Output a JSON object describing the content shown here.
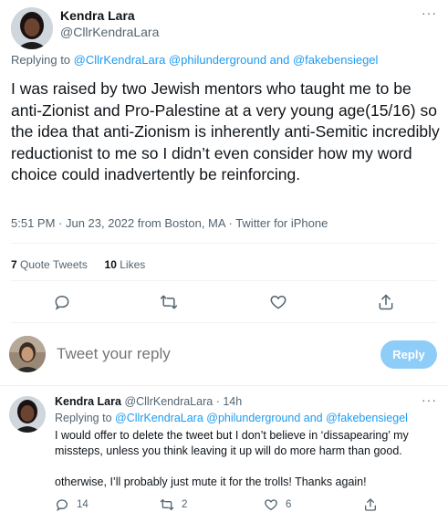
{
  "main_tweet": {
    "author_name": "Kendra Lara",
    "author_handle": "@CllrKendraLara",
    "replying_prefix": "Replying to",
    "replying_handles": "@CllrKendraLara @philunderground and @fakebensiegel",
    "text": "I was raised by two Jewish mentors who taught me to be anti-Zionist and Pro-Palestine at a very young age(15/16) so the idea that anti-Zionism is inherently anti-Semitic incredibly reductionist to me so I didn’t even consider how my word choice could inadvertently be reinforcing.",
    "timestamp": "5:51 PM · Jun 23, 2022 from Boston, MA",
    "client": "· Twitter for iPhone",
    "quote_count": "7",
    "quote_label": "Quote Tweets",
    "like_count": "10",
    "like_label": "Likes",
    "more_icon": "···"
  },
  "compose": {
    "placeholder": "Tweet your reply",
    "button_label": "Reply"
  },
  "reply_tweet": {
    "author_name": "Kendra Lara",
    "author_handle": "@CllrKendraLara",
    "time": "· 14h",
    "replying_prefix": "Replying to",
    "replying_handles": "@CllrKendraLara @philunderground and @fakebensiegel",
    "paragraph_1": "I would offer to delete the tweet but I don’t believe in ‘dissapearing’ my missteps, unless you think leaving it up will do more harm than good.",
    "paragraph_2": "otherwise, I’ll probably just mute it for the trolls! Thanks again!",
    "reply_count": "14",
    "retweet_count": "2",
    "like_count": "6",
    "more_icon": "···"
  },
  "colors": {
    "accent": "#1d9bf0",
    "muted": "#536471",
    "reply_button_disabled": "#8ecdf8",
    "divider": "#eff3f4"
  },
  "icons": [
    "reply-icon",
    "retweet-icon",
    "like-icon",
    "share-icon",
    "more-icon"
  ]
}
